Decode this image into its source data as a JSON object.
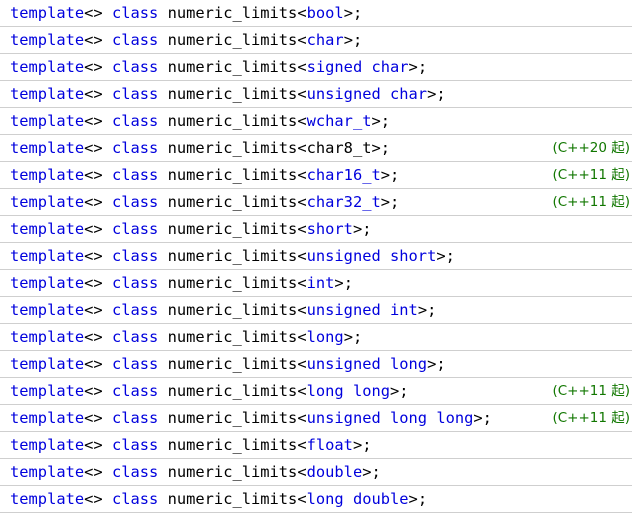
{
  "rows": [
    {
      "kw": "template",
      "lt": "<>",
      "cls": "class",
      "name": "numeric_limits",
      "open": "<",
      "type": "bool",
      "close": ">;",
      "version": ""
    },
    {
      "kw": "template",
      "lt": "<>",
      "cls": "class",
      "name": "numeric_limits",
      "open": "<",
      "type": "char",
      "close": ">;",
      "version": ""
    },
    {
      "kw": "template",
      "lt": "<>",
      "cls": "class",
      "name": "numeric_limits",
      "open": "<",
      "type": "signed char",
      "close": ">;",
      "version": ""
    },
    {
      "kw": "template",
      "lt": "<>",
      "cls": "class",
      "name": "numeric_limits",
      "open": "<",
      "type": "unsigned char",
      "close": ">;",
      "version": ""
    },
    {
      "kw": "template",
      "lt": "<>",
      "cls": "class",
      "name": "numeric_limits",
      "open": "<",
      "type": "wchar_t",
      "close": ">;",
      "version": ""
    },
    {
      "kw": "template",
      "lt": "<>",
      "cls": "class",
      "name": "numeric_limits",
      "open": "<",
      "type": "char8_t",
      "close": ">;",
      "version": "(C++20 起)",
      "type_plain": true
    },
    {
      "kw": "template",
      "lt": "<>",
      "cls": "class",
      "name": "numeric_limits",
      "open": "<",
      "type": "char16_t",
      "close": ">;",
      "version": "(C++11 起)"
    },
    {
      "kw": "template",
      "lt": "<>",
      "cls": "class",
      "name": "numeric_limits",
      "open": "<",
      "type": "char32_t",
      "close": ">;",
      "version": "(C++11 起)"
    },
    {
      "kw": "template",
      "lt": "<>",
      "cls": "class",
      "name": "numeric_limits",
      "open": "<",
      "type": "short",
      "close": ">;",
      "version": ""
    },
    {
      "kw": "template",
      "lt": "<>",
      "cls": "class",
      "name": "numeric_limits",
      "open": "<",
      "type": "unsigned short",
      "close": ">;",
      "version": ""
    },
    {
      "kw": "template",
      "lt": "<>",
      "cls": "class",
      "name": "numeric_limits",
      "open": "<",
      "type": "int",
      "close": ">;",
      "version": ""
    },
    {
      "kw": "template",
      "lt": "<>",
      "cls": "class",
      "name": "numeric_limits",
      "open": "<",
      "type": "unsigned int",
      "close": ">;",
      "version": ""
    },
    {
      "kw": "template",
      "lt": "<>",
      "cls": "class",
      "name": "numeric_limits",
      "open": "<",
      "type": "long",
      "close": ">;",
      "version": ""
    },
    {
      "kw": "template",
      "lt": "<>",
      "cls": "class",
      "name": "numeric_limits",
      "open": "<",
      "type": "unsigned long",
      "close": ">;",
      "version": ""
    },
    {
      "kw": "template",
      "lt": "<>",
      "cls": "class",
      "name": "numeric_limits",
      "open": "<",
      "type": "long long",
      "close": ">;",
      "version": "(C++11 起)"
    },
    {
      "kw": "template",
      "lt": "<>",
      "cls": "class",
      "name": "numeric_limits",
      "open": "<",
      "type": "unsigned long long",
      "close": ">;",
      "version": "(C++11 起)"
    },
    {
      "kw": "template",
      "lt": "<>",
      "cls": "class",
      "name": "numeric_limits",
      "open": "<",
      "type": "float",
      "close": ">;",
      "version": ""
    },
    {
      "kw": "template",
      "lt": "<>",
      "cls": "class",
      "name": "numeric_limits",
      "open": "<",
      "type": "double",
      "close": ">;",
      "version": ""
    },
    {
      "kw": "template",
      "lt": "<>",
      "cls": "class",
      "name": "numeric_limits",
      "open": "<",
      "type": "long double",
      "close": ">;",
      "version": ""
    }
  ],
  "colors": {
    "keyword": "#0000dd",
    "text": "#000000",
    "version": "#117700",
    "divider": "#cfcfcf"
  }
}
